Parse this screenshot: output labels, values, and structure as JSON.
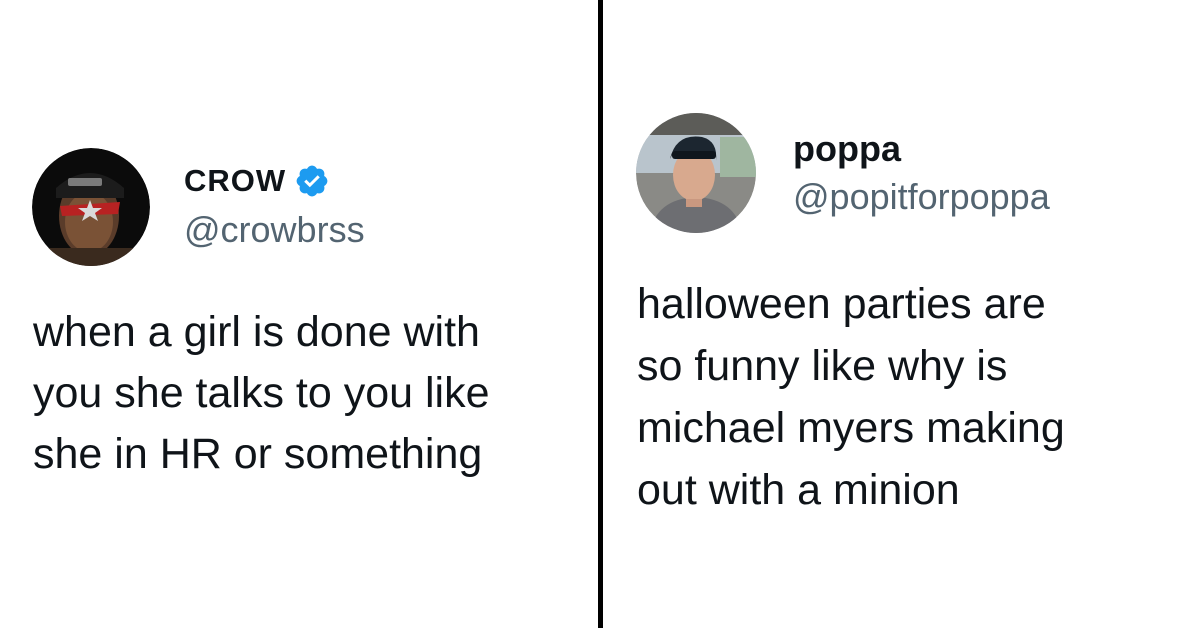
{
  "tweets": [
    {
      "display_name": "CROW",
      "handle": "@crowbrss",
      "verified": true,
      "avatar_icon": "profile-photo-masked-person",
      "text": "when a girl is done with\nyou she talks to you like\nshe in HR or something"
    },
    {
      "display_name": "poppa",
      "handle": "@popitforpoppa",
      "verified": false,
      "avatar_icon": "profile-photo-car-selfie",
      "text": "halloween parties are\nso funny like why is\nmichael myers making\nout with a minion"
    }
  ],
  "colors": {
    "verified_badge": "#1d9bf0",
    "handle": "#536471",
    "text": "#0f1419",
    "divider": "#000000"
  }
}
